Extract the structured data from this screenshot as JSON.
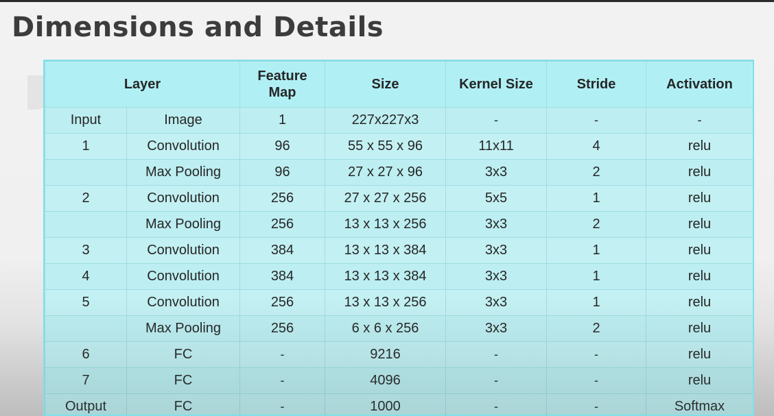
{
  "slide": {
    "title": "Dimensions and Details"
  },
  "table": {
    "headers": {
      "layer": "Layer",
      "feature_map": "Feature\nMap",
      "size": "Size",
      "kernel_size": "Kernel Size",
      "stride": "Stride",
      "activation": "Activation"
    },
    "rows": [
      [
        "Input",
        "Image",
        "1",
        "227x227x3",
        "-",
        "-",
        "-"
      ],
      [
        "1",
        "Convolution",
        "96",
        "55 x 55 x 96",
        "11x11",
        "4",
        "relu"
      ],
      [
        "",
        "Max Pooling",
        "96",
        "27 x 27 x 96",
        "3x3",
        "2",
        "relu"
      ],
      [
        "2",
        "Convolution",
        "256",
        "27 x 27 x 256",
        "5x5",
        "1",
        "relu"
      ],
      [
        "",
        "Max Pooling",
        "256",
        "13 x 13 x 256",
        "3x3",
        "2",
        "relu"
      ],
      [
        "3",
        "Convolution",
        "384",
        "13 x 13 x 384",
        "3x3",
        "1",
        "relu"
      ],
      [
        "4",
        "Convolution",
        "384",
        "13 x 13 x 384",
        "3x3",
        "1",
        "relu"
      ],
      [
        "5",
        "Convolution",
        "256",
        "13 x 13 x 256",
        "3x3",
        "1",
        "relu"
      ],
      [
        "",
        "Max Pooling",
        "256",
        "6 x 6 x 256",
        "3x3",
        "2",
        "relu"
      ],
      [
        "6",
        "FC",
        "-",
        "9216",
        "-",
        "-",
        "relu"
      ],
      [
        "7",
        "FC",
        "-",
        "4096",
        "-",
        "-",
        "relu"
      ],
      [
        "Output",
        "FC",
        "-",
        "1000",
        "-",
        "-",
        "Softmax"
      ]
    ]
  }
}
